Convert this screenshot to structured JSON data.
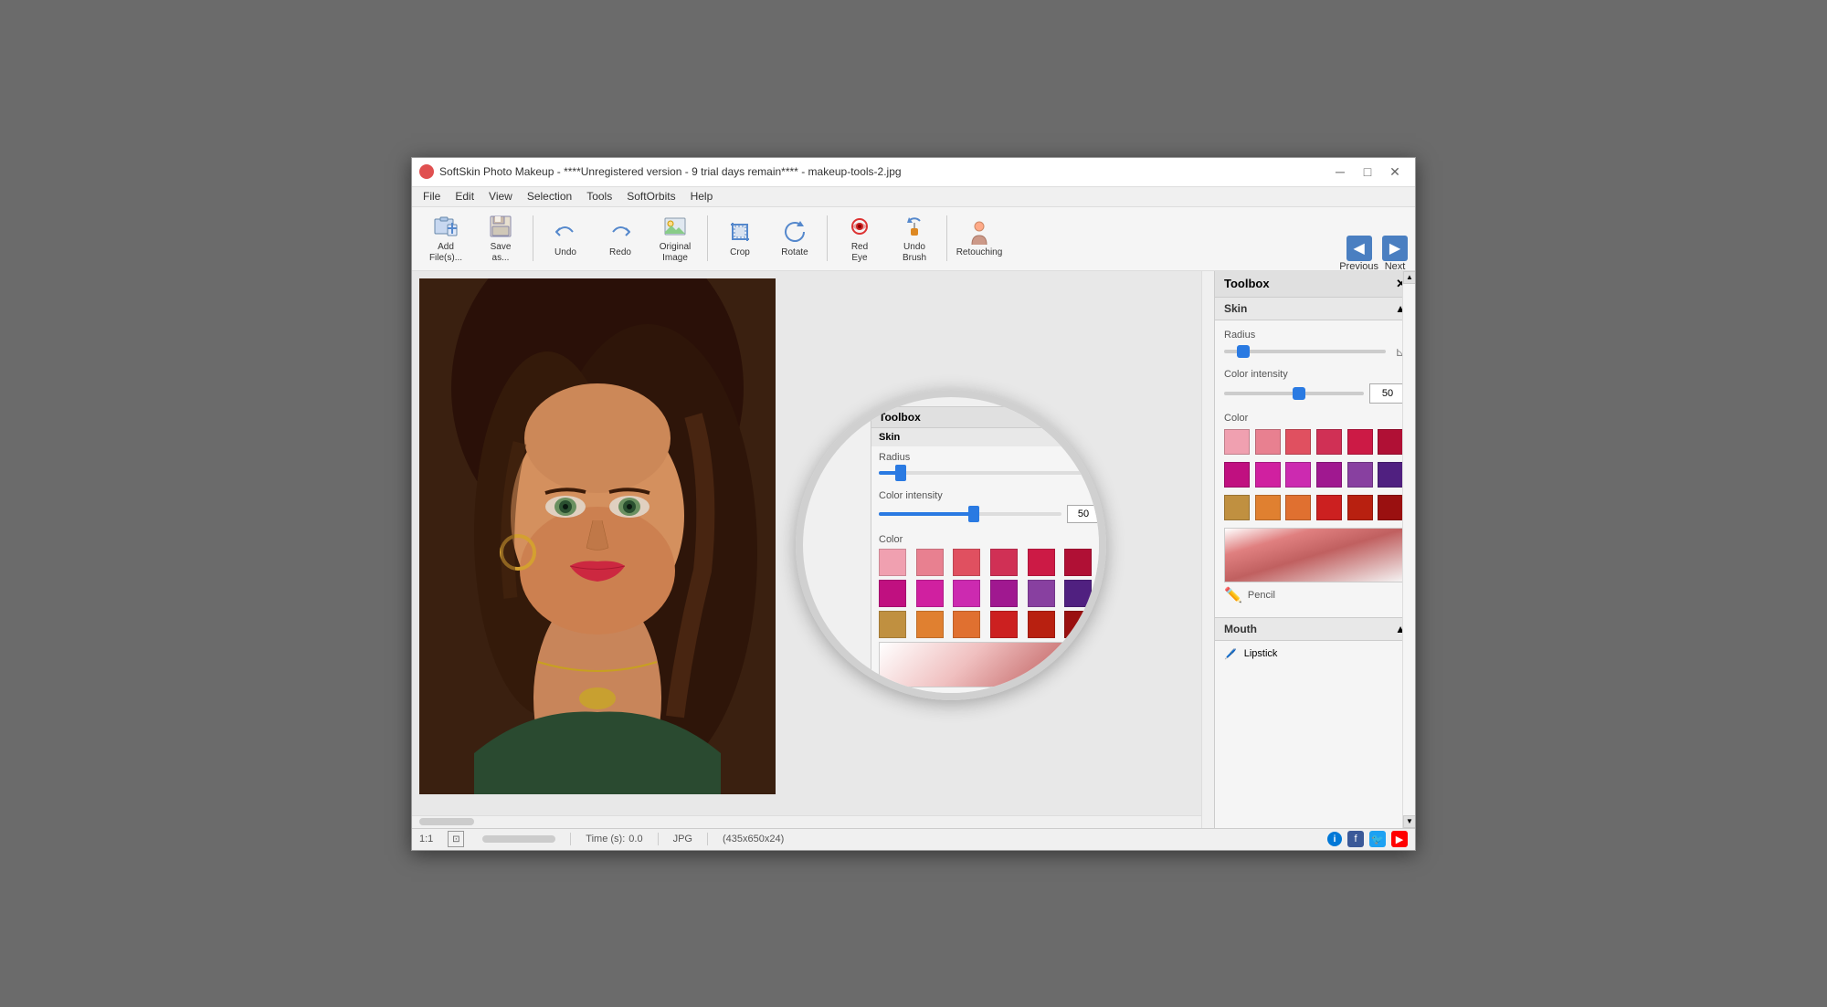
{
  "window": {
    "title": "SoftSkin Photo Makeup - ****Unregistered version - 9 trial days remain**** - makeup-tools-2.jpg",
    "icon_color": "#e05050"
  },
  "titlebar": {
    "minimize_label": "─",
    "maximize_label": "□",
    "close_label": "✕"
  },
  "menu": {
    "items": [
      "File",
      "Edit",
      "View",
      "Selection",
      "Tools",
      "SoftOrbits",
      "Help"
    ]
  },
  "toolbar": {
    "buttons": [
      {
        "id": "add-files",
        "label": "Add\nFile(s)...",
        "icon": "📁"
      },
      {
        "id": "save-as",
        "label": "Save\nas...",
        "icon": "💾"
      },
      {
        "id": "undo",
        "label": "Undo",
        "icon": "↩"
      },
      {
        "id": "redo",
        "label": "Redo",
        "icon": "↪"
      },
      {
        "id": "original-image",
        "label": "Original\nImage",
        "icon": "🖼"
      },
      {
        "id": "crop",
        "label": "Crop",
        "icon": "✂"
      },
      {
        "id": "rotate",
        "label": "Rotate",
        "icon": "🔄"
      },
      {
        "id": "red-eye",
        "label": "Red\nEye",
        "icon": "👁"
      },
      {
        "id": "undo-brush",
        "label": "Undo\nBrush",
        "icon": "🖌"
      },
      {
        "id": "retouching",
        "label": "Retouching",
        "icon": "👤"
      }
    ],
    "nav": {
      "previous_label": "Previous",
      "next_label": "Next"
    }
  },
  "toolbox": {
    "title": "Toolbox",
    "sections": {
      "skin": {
        "label": "Skin"
      },
      "radius": {
        "label": "Radius",
        "value": 10,
        "thumb_percent": 12
      },
      "color_intensity": {
        "label": "Color intensity",
        "value": 50,
        "thumb_percent": 55
      },
      "color": {
        "label": "Color",
        "swatches_row1": [
          "#f0a0b0",
          "#e88090",
          "#e05060",
          "#d03055",
          "#cc1a45",
          "#b01035"
        ],
        "swatches_row2": [
          "#c01080",
          "#d020a0",
          "#cc2ab0",
          "#a01890",
          "#8840a0",
          "#502080"
        ],
        "swatches_row3": [
          "#c09040",
          "#e08030",
          "#e07030",
          "#cc2020",
          "#b82010",
          "#9a1010"
        ]
      },
      "pencil_label": "Pencil"
    },
    "mouth": {
      "label": "Mouth",
      "tool": "Lipstick"
    }
  },
  "statusbar": {
    "zoom": "1:1",
    "time_label": "Time (s):",
    "time_value": "0.0",
    "format": "JPG",
    "dimensions": "(435x650x24)"
  }
}
